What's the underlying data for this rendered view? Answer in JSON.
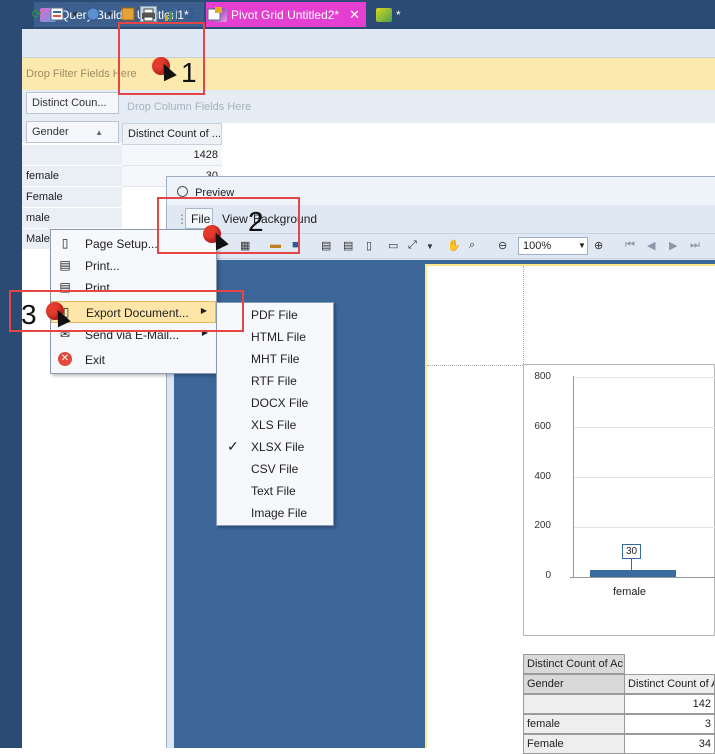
{
  "tabs": [
    {
      "label": "Query Builder Untitled1*"
    },
    {
      "label": "Pivot Grid Untitled2*",
      "close": "✕",
      "active": true
    },
    {
      "label": "*"
    }
  ],
  "colors": {
    "active_tab": "#e43fd1",
    "tab_strip": "#2b4a74",
    "filter_zone": "#fbe9ad",
    "canvas": "#3c6698",
    "bar": "#3b6aa0",
    "annotation": "#e64545"
  },
  "toolbar_icons": [
    "refresh-icon",
    "data-source-icon",
    "connect-icon",
    "layout-icon",
    "print-preview-icon",
    "chart-icon",
    "sum-icon",
    "settings-icon"
  ],
  "pivot": {
    "filter_placeholder": "Drop Filter Fields Here",
    "data_field": "Distinct Coun...",
    "column_placeholder": "Drop Column Fields Here",
    "row_field": "Gender",
    "value_header": "Distinct Count of ...",
    "rows": [
      {
        "label": "",
        "value": "1428"
      },
      {
        "label": "female",
        "value": "30"
      },
      {
        "label": "Female",
        "value": ""
      },
      {
        "label": "male",
        "value": ""
      },
      {
        "label": "Male",
        "value": ""
      }
    ]
  },
  "preview": {
    "title": "Preview",
    "menu": {
      "file": "File",
      "view": "View",
      "background": "Background"
    },
    "zoom": "100%"
  },
  "file_menu": {
    "items": [
      {
        "label": "Page Setup...",
        "icon": "page-setup-icon"
      },
      {
        "label": "Print...",
        "icon": "print-icon"
      },
      {
        "label": "Print",
        "icon": "quick-print-icon"
      },
      {
        "label": "Export Document...",
        "icon": "export-icon",
        "submenu": "▶"
      },
      {
        "label": "Send via E-Mail...",
        "icon": "email-icon",
        "submenu": "▶"
      },
      {
        "label": "Exit",
        "icon": "exit-icon"
      }
    ]
  },
  "export_menu": {
    "items": [
      "PDF File",
      "HTML File",
      "MHT File",
      "RTF File",
      "DOCX File",
      "XLS File",
      "XLSX File",
      "CSV File",
      "Text File",
      "Image File"
    ],
    "checked": "XLSX File",
    "check_mark": "✓"
  },
  "chart_data": {
    "type": "bar",
    "categories": [
      "female"
    ],
    "values": [
      30
    ],
    "data_labels": [
      "30"
    ],
    "yticks": [
      "800",
      "600",
      "400",
      "200",
      "0"
    ],
    "ylim": [
      0,
      800
    ]
  },
  "report_table": {
    "title": "Distinct Count of Ac",
    "header": [
      "Gender",
      "Distinct Count of A"
    ],
    "rows": [
      [
        "",
        "142"
      ],
      [
        "female",
        "3"
      ],
      [
        "Female",
        "34"
      ]
    ]
  },
  "annotations": {
    "step1": "1",
    "step2": "2",
    "step3": "3"
  }
}
